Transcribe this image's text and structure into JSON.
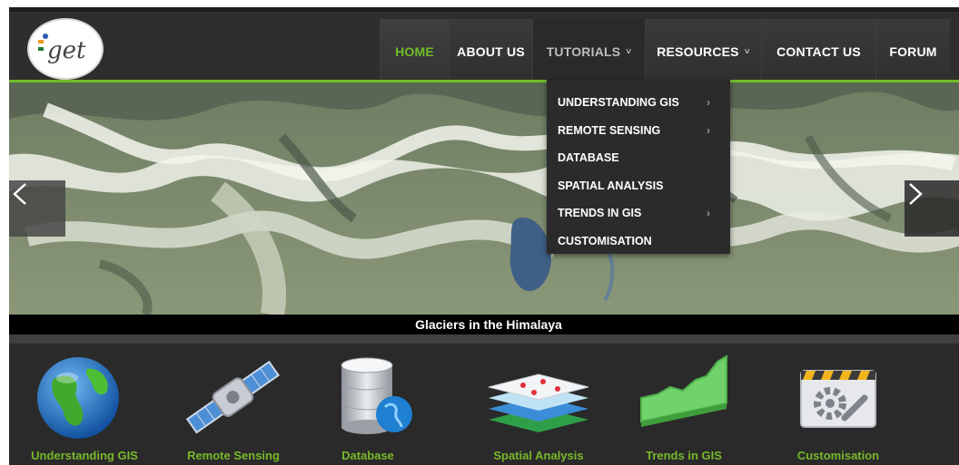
{
  "brand": {
    "logo_text": "get"
  },
  "nav": {
    "items": [
      {
        "label": "HOME",
        "caret": ""
      },
      {
        "label": "ABOUT US",
        "caret": ""
      },
      {
        "label": "TUTORIALS",
        "caret": "˅"
      },
      {
        "label": "RESOURCES",
        "caret": "˅"
      },
      {
        "label": "CONTACT US",
        "caret": ""
      },
      {
        "label": "FORUM",
        "caret": ""
      }
    ],
    "active": "HOME",
    "open_menu": "TUTORIALS"
  },
  "dropdown": {
    "items": [
      {
        "label": "UNDERSTANDING GIS",
        "arrow": "›"
      },
      {
        "label": "REMOTE SENSING",
        "arrow": "›"
      },
      {
        "label": "DATABASE",
        "arrow": ""
      },
      {
        "label": "SPATIAL ANALYSIS",
        "arrow": ""
      },
      {
        "label": "TRENDS IN GIS",
        "arrow": "›"
      },
      {
        "label": "CUSTOMISATION",
        "arrow": ""
      }
    ]
  },
  "slider": {
    "caption": "Glaciers in the Himalaya",
    "prev_icon": "chevron-left-icon",
    "next_icon": "chevron-right-icon"
  },
  "features": [
    {
      "label": "Understanding GIS",
      "icon": "globe-icon"
    },
    {
      "label": "Remote Sensing",
      "icon": "satellite-icon"
    },
    {
      "label": "Database",
      "icon": "database-icon"
    },
    {
      "label": "Spatial Analysis",
      "icon": "layers-icon"
    },
    {
      "label": "Trends in GIS",
      "icon": "area-chart-icon"
    },
    {
      "label": "Customisation",
      "icon": "tools-icon"
    }
  ],
  "colors": {
    "accent": "#6fbd2a",
    "header_bg": "#2e2e2e",
    "caption_bg": "#000000",
    "feature_label": "#79b82a"
  }
}
